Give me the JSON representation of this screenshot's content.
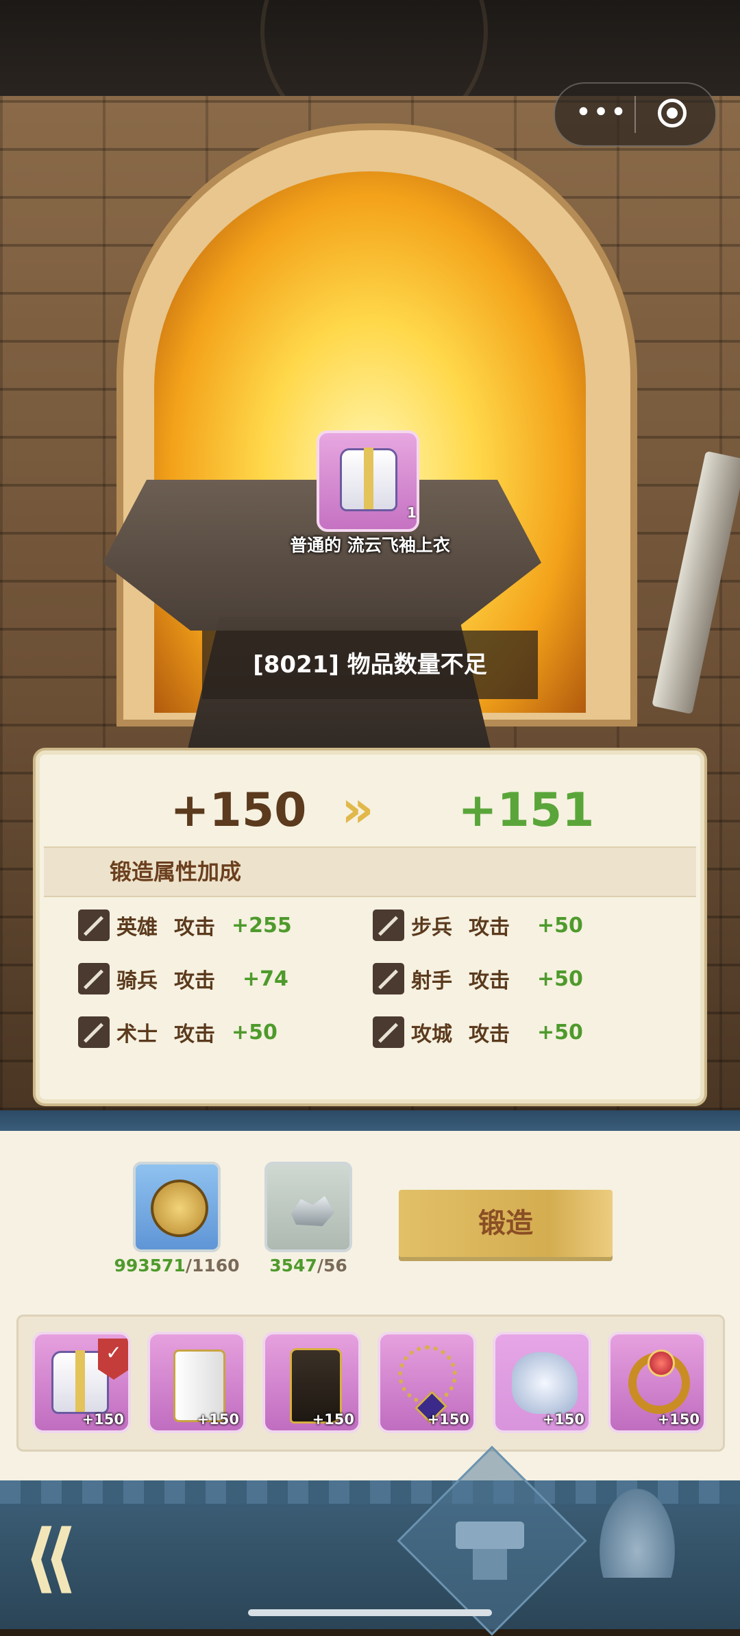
{
  "item": {
    "name": "普通的 流云飞袖上衣",
    "quantity": "1"
  },
  "toast": "[8021] 物品数量不足",
  "upgrade": {
    "current": "+150",
    "next": "+151",
    "arrow": "»"
  },
  "bonus": {
    "title": "锻造属性加成",
    "stats": [
      {
        "unit": "英雄",
        "attr": "攻击",
        "value": "+255"
      },
      {
        "unit": "步兵",
        "attr": "攻击",
        "value": "+50"
      },
      {
        "unit": "骑兵",
        "attr": "攻击",
        "value": "+74"
      },
      {
        "unit": "射手",
        "attr": "攻击",
        "value": "+50"
      },
      {
        "unit": "术士",
        "attr": "攻击",
        "value": "+50"
      },
      {
        "unit": "攻城",
        "attr": "攻击",
        "value": "+50"
      }
    ]
  },
  "costs": [
    {
      "icon": "gold-coin-icon",
      "have": "993571",
      "need": "/1160"
    },
    {
      "icon": "ore-icon",
      "have": "3547",
      "need": "/56"
    }
  ],
  "forge_button": "锻造",
  "equipment": [
    {
      "icon": "robe-icon",
      "level": "+150",
      "selected": true
    },
    {
      "icon": "pants-icon",
      "level": "+150"
    },
    {
      "icon": "boots-icon",
      "level": "+150"
    },
    {
      "icon": "necklace-icon",
      "level": "+150"
    },
    {
      "icon": "gauntlet-icon",
      "level": "+150"
    },
    {
      "icon": "ring-icon",
      "level": "+150"
    }
  ],
  "badge": "✓",
  "menu": {
    "more": "•••"
  },
  "nav": {
    "back": "⟪"
  },
  "colors": {
    "accent_green": "#4e9a2c",
    "brown": "#5b3a1d",
    "gold": "#e1b84a",
    "rarity_purple": "#c06dc0"
  }
}
